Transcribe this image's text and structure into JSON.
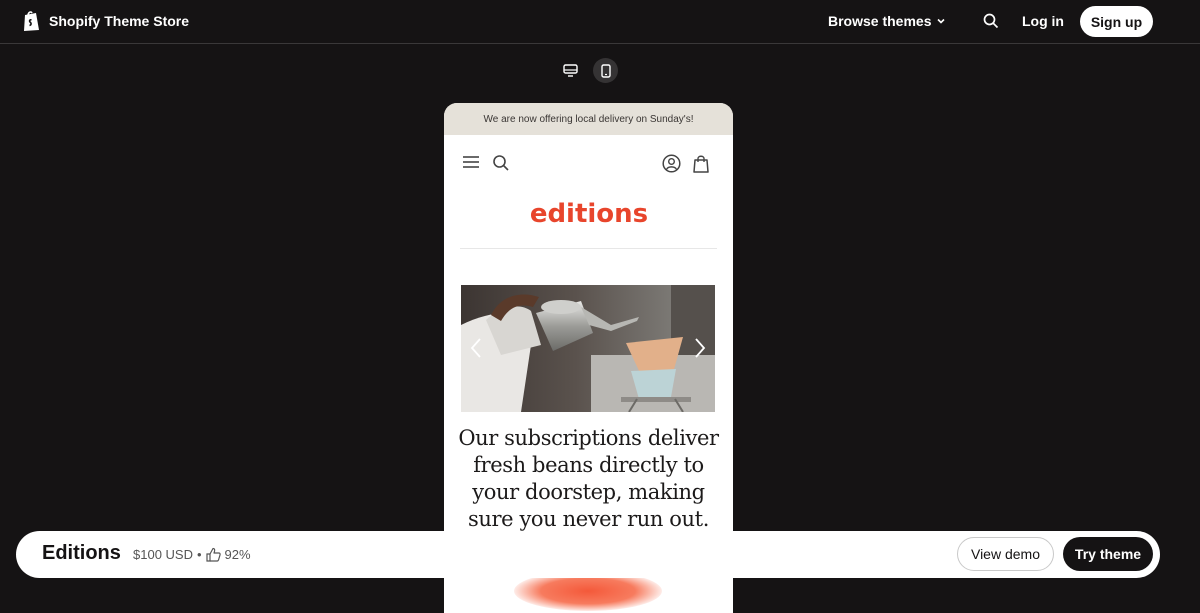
{
  "header": {
    "brand": "Shopify Theme Store",
    "browse_label": "Browse themes",
    "login_label": "Log in",
    "signup_label": "Sign up"
  },
  "device_toggle": {
    "options": [
      "desktop",
      "mobile"
    ],
    "selected": "mobile"
  },
  "preview": {
    "announcement": "We are now offering local delivery on Sunday's!",
    "store_logo": "editions",
    "headline_lines": [
      "Our subscriptions deliver",
      "fresh beans directly to",
      "your doorstep, making",
      "sure you never run out."
    ]
  },
  "theme_bar": {
    "name": "Editions",
    "price": "$100 USD",
    "separator": "•",
    "rating": "92%",
    "view_demo_label": "View demo",
    "try_theme_label": "Try theme"
  },
  "colors": {
    "background": "#151314",
    "accent": "#e8452c",
    "announcement_bg": "#e5e1d9"
  }
}
